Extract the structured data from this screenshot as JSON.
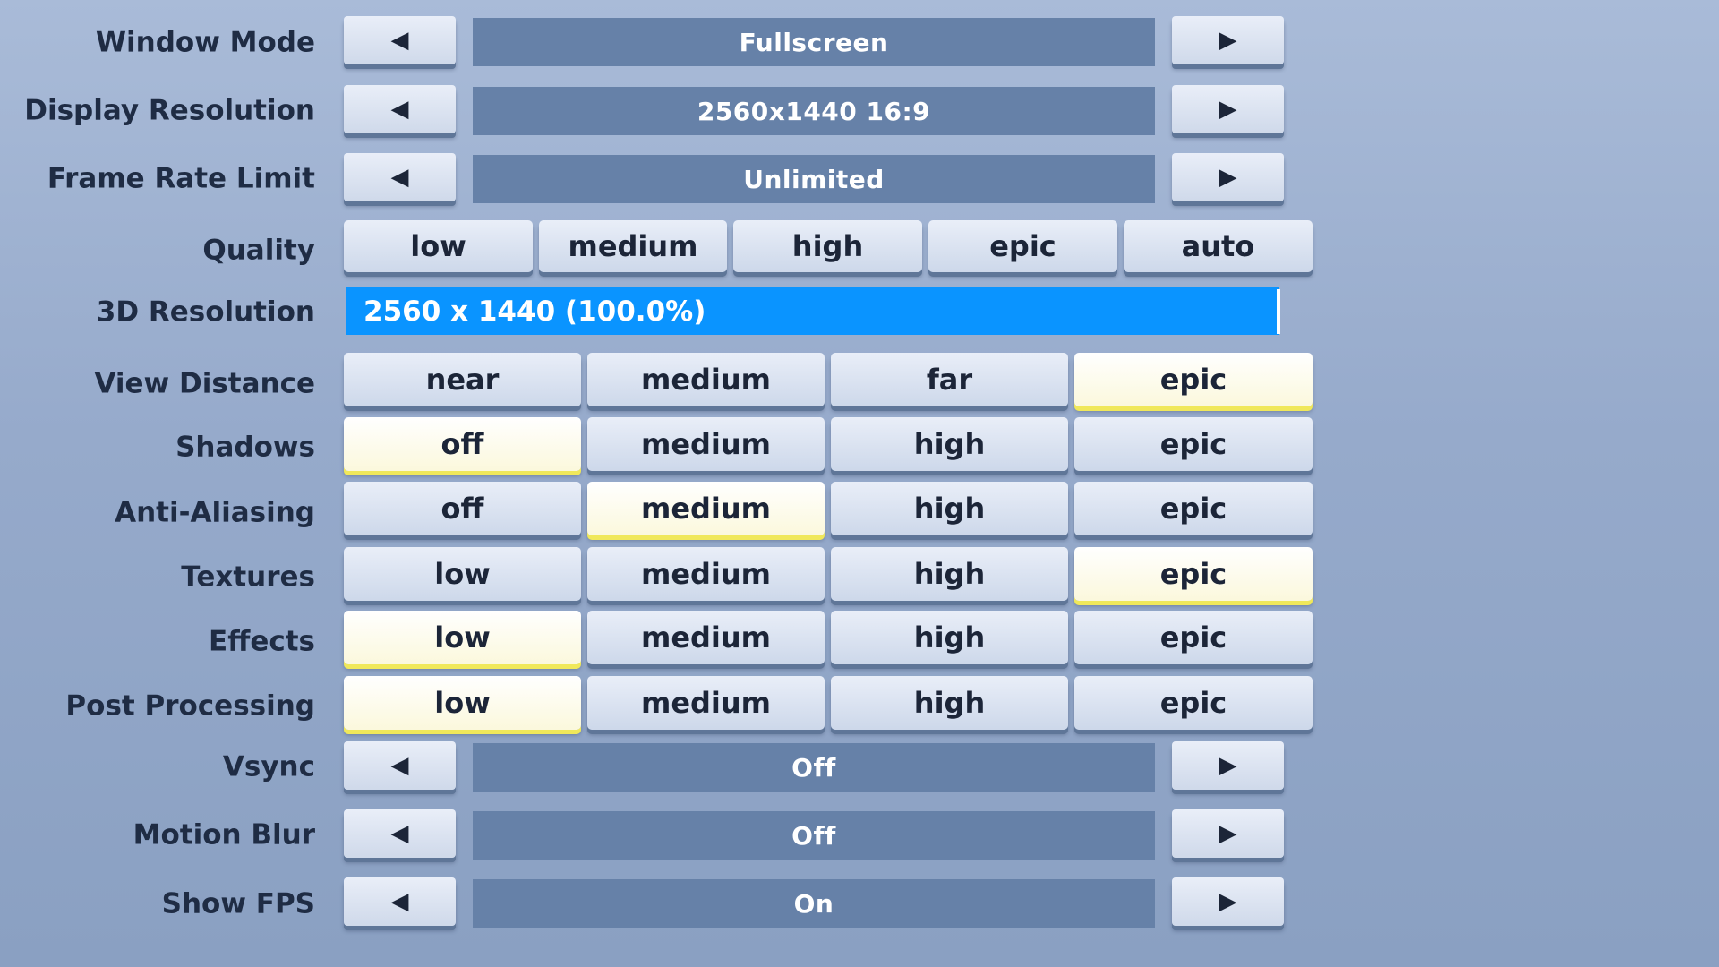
{
  "rows": {
    "window_mode": {
      "label": "Window Mode",
      "value": "Fullscreen",
      "prev": "◀",
      "next": "▶"
    },
    "display_resolution": {
      "label": "Display Resolution",
      "value": "2560x1440 16:9",
      "prev": "◀",
      "next": "▶"
    },
    "frame_rate_limit": {
      "label": "Frame Rate Limit",
      "value": "Unlimited",
      "prev": "◀",
      "next": "▶"
    },
    "quality": {
      "label": "Quality",
      "options": [
        "low",
        "medium",
        "high",
        "epic",
        "auto"
      ]
    },
    "resolution_3d": {
      "label": "3D Resolution",
      "value": "2560 x 1440 (100.0%)",
      "percent": 100
    },
    "view_distance": {
      "label": "View Distance",
      "options": [
        "near",
        "medium",
        "far",
        "epic"
      ],
      "selected": "epic"
    },
    "shadows": {
      "label": "Shadows",
      "options": [
        "off",
        "medium",
        "high",
        "epic"
      ],
      "selected": "off"
    },
    "anti_aliasing": {
      "label": "Anti-Aliasing",
      "options": [
        "off",
        "medium",
        "high",
        "epic"
      ],
      "selected": "medium"
    },
    "textures": {
      "label": "Textures",
      "options": [
        "low",
        "medium",
        "high",
        "epic"
      ],
      "selected": "epic"
    },
    "effects": {
      "label": "Effects",
      "options": [
        "low",
        "medium",
        "high",
        "epic"
      ],
      "selected": "low"
    },
    "post_processing": {
      "label": "Post Processing",
      "options": [
        "low",
        "medium",
        "high",
        "epic"
      ],
      "selected": "low"
    },
    "vsync": {
      "label": "Vsync",
      "value": "Off",
      "prev": "◀",
      "next": "▶"
    },
    "motion_blur": {
      "label": "Motion Blur",
      "value": "Off",
      "prev": "◀",
      "next": "▶"
    },
    "show_fps": {
      "label": "Show FPS",
      "value": "On",
      "prev": "◀",
      "next": "▶"
    }
  },
  "colors": {
    "selected_highlight": "#f0e85a",
    "slider_fill": "#0a94ff",
    "value_box": "#6681a8",
    "label_text": "#1f2c44"
  }
}
